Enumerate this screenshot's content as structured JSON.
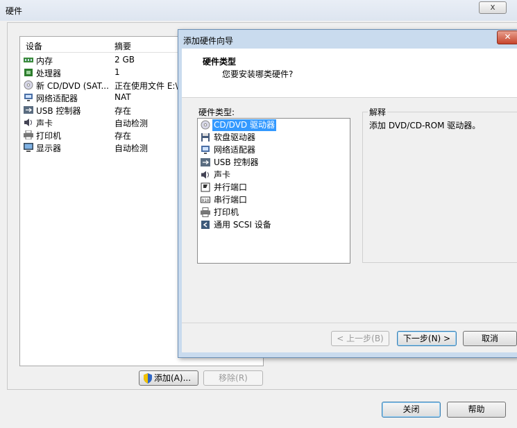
{
  "window": {
    "title": "硬件",
    "close_glyph": "x"
  },
  "devices": {
    "headers": {
      "device": "设备",
      "summary": "摘要"
    },
    "rows": [
      {
        "name": "内存",
        "summary": "2 GB",
        "icon": "memory-icon"
      },
      {
        "name": "处理器",
        "summary": "1",
        "icon": "processor-icon"
      },
      {
        "name": "新 CD/DVD (SAT...",
        "summary": "正在使用文件 E:\\",
        "icon": "cd-icon"
      },
      {
        "name": "网络适配器",
        "summary": "NAT",
        "icon": "network-icon"
      },
      {
        "name": "USB 控制器",
        "summary": "存在",
        "icon": "usb-icon"
      },
      {
        "name": "声卡",
        "summary": "自动检测",
        "icon": "sound-icon"
      },
      {
        "name": "打印机",
        "summary": "存在",
        "icon": "printer-icon"
      },
      {
        "name": "显示器",
        "summary": "自动检测",
        "icon": "display-icon"
      }
    ]
  },
  "buttons": {
    "add": "添加(A)...",
    "remove": "移除(R)",
    "close": "关闭",
    "help": "帮助"
  },
  "wizard": {
    "title": "添加硬件向导",
    "close_glyph": "✕",
    "heading": "硬件类型",
    "subheading": "您要安装哪类硬件?",
    "list_label": "硬件类型:",
    "items": [
      {
        "name": "CD/DVD 驱动器",
        "icon": "cd-icon",
        "selected": true
      },
      {
        "name": "软盘驱动器",
        "icon": "floppy-icon",
        "selected": false
      },
      {
        "name": "网络适配器",
        "icon": "network-icon",
        "selected": false
      },
      {
        "name": "USB 控制器",
        "icon": "usb-icon",
        "selected": false
      },
      {
        "name": "声卡",
        "icon": "sound-icon",
        "selected": false
      },
      {
        "name": "并行端口",
        "icon": "parallel-port-icon",
        "selected": false
      },
      {
        "name": "串行端口",
        "icon": "serial-port-icon",
        "selected": false
      },
      {
        "name": "打印机",
        "icon": "printer-icon",
        "selected": false
      },
      {
        "name": "通用 SCSI 设备",
        "icon": "scsi-icon",
        "selected": false
      }
    ],
    "explanation_label": "解释",
    "explanation": "添加 DVD/CD-ROM 驱动器。",
    "buttons": {
      "back": "< 上一步(B)",
      "next": "下一步(N) >",
      "cancel": "取消"
    }
  },
  "colors": {
    "selection": "#3399ff",
    "wizard_frame": "#c9dbee",
    "window_bg": "#f0f0f0"
  }
}
